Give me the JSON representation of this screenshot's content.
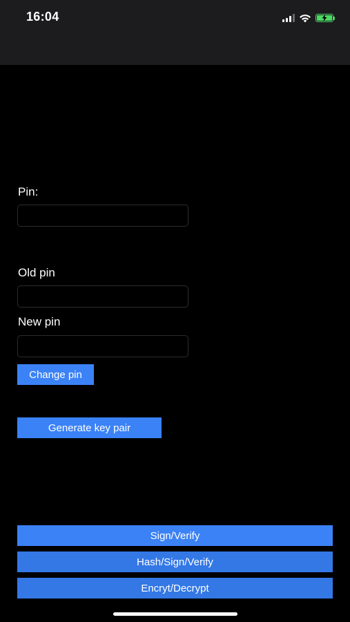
{
  "status_bar": {
    "time": "16:04",
    "battery_color": "#4cd964",
    "battery_level": 1.0,
    "icons": [
      "cellular-signal-icon",
      "wifi-icon",
      "battery-charging-icon"
    ]
  },
  "form": {
    "pin": {
      "label": "Pin:",
      "value": ""
    },
    "old_pin": {
      "label": "Old pin",
      "value": ""
    },
    "new_pin": {
      "label": "New pin",
      "value": ""
    },
    "change_pin_label": "Change pin",
    "generate_key_pair_label": "Generate key pair"
  },
  "actions": {
    "sign_verify_label": "Sign/Verify",
    "hash_sign_verify_label": "Hash/Sign/Verify",
    "encrypt_decrypt_label": "Encryt/Decrypt"
  },
  "colors": {
    "accent": "#3b82f6",
    "background": "#000000",
    "status_bar_bg": "#1c1c1e"
  }
}
